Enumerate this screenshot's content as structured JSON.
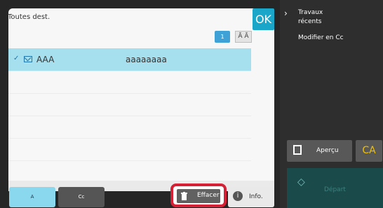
{
  "header": {
    "title": "Toutes dest.",
    "ok_label": "OK"
  },
  "list": {
    "page": "1",
    "sort_label": "Ā Ā",
    "rows": [
      {
        "name": "AAA",
        "address": "aaaaaaaa",
        "selected": true
      }
    ]
  },
  "tabs": [
    {
      "label": "A",
      "active": true
    },
    {
      "label": "Cc",
      "active": false
    }
  ],
  "actions": {
    "clear_label": "Effacer",
    "info_label": "Info."
  },
  "sidebar": {
    "recent_label": "Travaux récents",
    "modify_label": "Modifier en Cc",
    "preview_label": "Aperçu",
    "ca_label": "CA",
    "start_label": "Départ"
  },
  "colors": {
    "ok_button": "#1aa6c9",
    "selected_row": "#a6e0ee",
    "highlight": "#d62035",
    "ca_text": "#f0c000"
  },
  "icons": [
    "check-icon",
    "mail-icon",
    "trash-icon",
    "info-icon",
    "chevron-right-icon",
    "preview-icon",
    "start-icon"
  ]
}
